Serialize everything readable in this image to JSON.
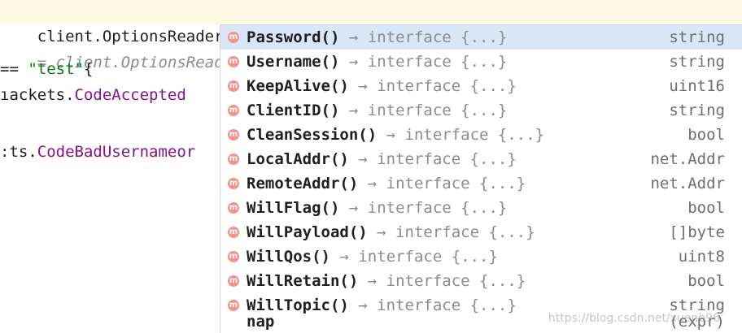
{
  "editor": {
    "line1": "client.OptionsReader().",
    "line2": "= client.OptionsRead",
    "line3_op": "== ",
    "line3_str": "\"test\"",
    "line3_brace": "{",
    "line4_prefix": "ıackets.",
    "line4_const": "CodeAccepted",
    "line6_prefix": ":ts.",
    "line6_const": "CodeBadUsernameor"
  },
  "completion": {
    "items": [
      {
        "name": "Password()",
        "arrow": "→",
        "sig": "interface {...}",
        "type": "string",
        "badge": "m"
      },
      {
        "name": "Username()",
        "arrow": "→",
        "sig": "interface {...}",
        "type": "string",
        "badge": "m"
      },
      {
        "name": "KeepAlive()",
        "arrow": "→",
        "sig": "interface {...}",
        "type": "uint16",
        "badge": "m"
      },
      {
        "name": "ClientID()",
        "arrow": "→",
        "sig": "interface {...}",
        "type": "string",
        "badge": "m"
      },
      {
        "name": "CleanSession()",
        "arrow": "→",
        "sig": "interface {...}",
        "type": "bool",
        "badge": "m"
      },
      {
        "name": "LocalAddr()",
        "arrow": "→",
        "sig": "interface {...}",
        "type": "net.Addr",
        "badge": "m"
      },
      {
        "name": "RemoteAddr()",
        "arrow": "→",
        "sig": "interface {...}",
        "type": "net.Addr",
        "badge": "m"
      },
      {
        "name": "WillFlag()",
        "arrow": "→",
        "sig": "interface {...}",
        "type": "bool",
        "badge": "m"
      },
      {
        "name": "WillPayload()",
        "arrow": "→",
        "sig": "interface {...}",
        "type": "[]byte",
        "badge": "m"
      },
      {
        "name": "WillQos()",
        "arrow": "→",
        "sig": "interface {...}",
        "type": "uint8",
        "badge": "m"
      },
      {
        "name": "WillRetain()",
        "arrow": "→",
        "sig": "interface {...}",
        "type": "bool",
        "badge": "m"
      },
      {
        "name": "WillTopic()",
        "arrow": "→",
        "sig": "interface {...}",
        "type": "string",
        "badge": "m"
      }
    ],
    "partial_row": {
      "name": "nap",
      "type": "(expr)"
    }
  },
  "watermark": "https://blog.csdn.net/xuenb96",
  "colors": {
    "line_highlight": "#fdf9e3",
    "selection": "#d8e6f7",
    "method_badge": "#f2938b",
    "string_literal": "#067d17",
    "constant": "#871094"
  }
}
